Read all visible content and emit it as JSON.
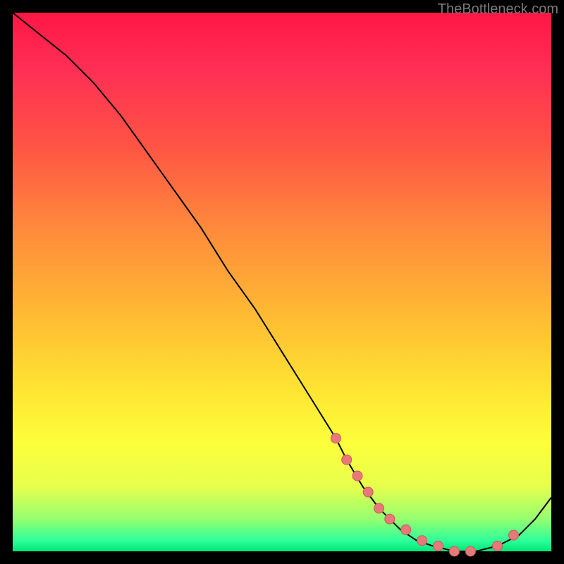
{
  "watermark": "TheBottleneck.com",
  "chart_data": {
    "type": "line",
    "title": "",
    "xlabel": "",
    "ylabel": "",
    "xlim": [
      0,
      100
    ],
    "ylim": [
      0,
      100
    ],
    "series": [
      {
        "name": "curve",
        "x": [
          0,
          5,
          10,
          15,
          20,
          25,
          30,
          35,
          40,
          45,
          50,
          55,
          60,
          62,
          65,
          68,
          72,
          75,
          78,
          82,
          86,
          90,
          94,
          97,
          100
        ],
        "y": [
          100,
          96,
          92,
          87,
          81,
          74,
          67,
          60,
          52,
          45,
          37,
          29,
          21,
          17,
          12,
          8,
          4,
          2,
          1,
          0,
          0,
          1,
          3,
          6,
          10
        ]
      }
    ],
    "markers": {
      "name": "points",
      "x": [
        60,
        62,
        64,
        66,
        68,
        70,
        73,
        76,
        79,
        82,
        85,
        90,
        93
      ],
      "y": [
        21,
        17,
        14,
        11,
        8,
        6,
        4,
        2,
        1,
        0,
        0,
        1,
        3
      ]
    },
    "colors": {
      "curve": "#000000",
      "marker_fill": "#e67a7a",
      "marker_stroke": "#d05858"
    }
  }
}
